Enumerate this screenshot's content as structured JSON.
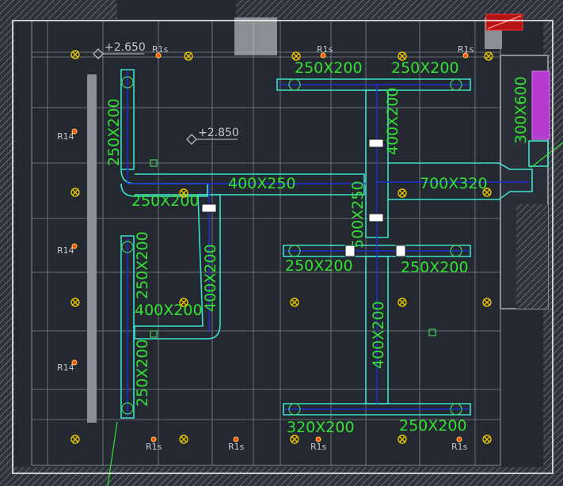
{
  "colors": {
    "background": "#242831",
    "wall": "#8a8f96",
    "grid": "#c9cdd2",
    "duct": "#3fe0d0",
    "duct_center": "#1c2dd8",
    "duct_label": "#33e033",
    "level_label": "#c8c8c8",
    "room_tag": "#c8c8c8",
    "light": "#e6c200",
    "sprinkler": "#ff5010",
    "diffuser": "#3fd060",
    "riser_equipment": "#b43ad0",
    "alarm": "#d01818",
    "view_border": "#ffffff"
  },
  "levels": [
    "+2.650",
    "+2.850"
  ],
  "duct_labels": [
    "250X200",
    "250X200",
    "250X200",
    "400X250",
    "250X200",
    "400X200",
    "700X320",
    "300X600",
    "500X250",
    "250X200",
    "250X200",
    "250X200",
    "400X200",
    "400X200",
    "400X200",
    "250X200",
    "320X200",
    "250X200"
  ],
  "room_tags": [
    "R1s",
    "R1s",
    "R1s",
    "R14",
    "R14",
    "R14",
    "R1s",
    "R1s",
    "R1s",
    "R1s"
  ]
}
